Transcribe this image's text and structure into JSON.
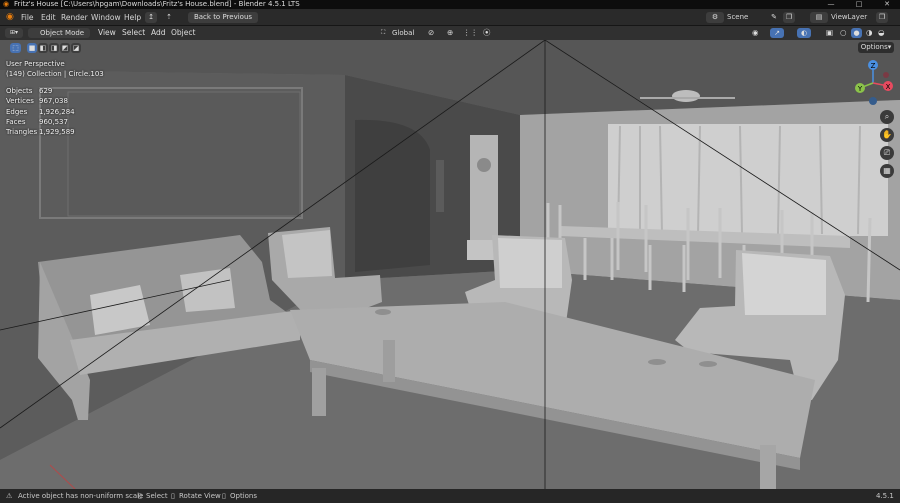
{
  "window": {
    "title": "Fritz's House [C:\\Users\\hpgam\\Downloads\\Fritz's House.blend] - Blender 4.5.1 LTS",
    "minimize": "—",
    "maximize": "□",
    "close": "✕"
  },
  "topbar": {
    "menus": [
      "File",
      "Edit",
      "Render",
      "Window",
      "Help"
    ],
    "back_button": "Back to Previous",
    "scene": "Scene",
    "view_layer": "ViewLayer"
  },
  "header": {
    "mode": "Object Mode",
    "menus": [
      "View",
      "Select",
      "Add",
      "Object"
    ],
    "orientation": "Global",
    "options": "Options"
  },
  "overlay": {
    "perspective": "User Perspective",
    "collection": "(149) Collection | Circle.103"
  },
  "stats": [
    {
      "label": "Objects",
      "value": "629"
    },
    {
      "label": "Vertices",
      "value": "967,038"
    },
    {
      "label": "Edges",
      "value": "1,926,284"
    },
    {
      "label": "Faces",
      "value": "960,537"
    },
    {
      "label": "Triangles",
      "value": "1,929,589"
    }
  ],
  "gizmo": {
    "x": "X",
    "y": "Y",
    "z": "Z"
  },
  "statusbar": {
    "message": "Active object has non-uniform scale",
    "select": "Select",
    "rotate": "Rotate View",
    "options": "Options",
    "version": "4.5.1"
  },
  "colors": {
    "accent": "#4772b3",
    "viewport": "#6a6a6a",
    "x_axis": "#e84a5f",
    "y_axis": "#8bc34a",
    "z_axis": "#4a90e2"
  }
}
